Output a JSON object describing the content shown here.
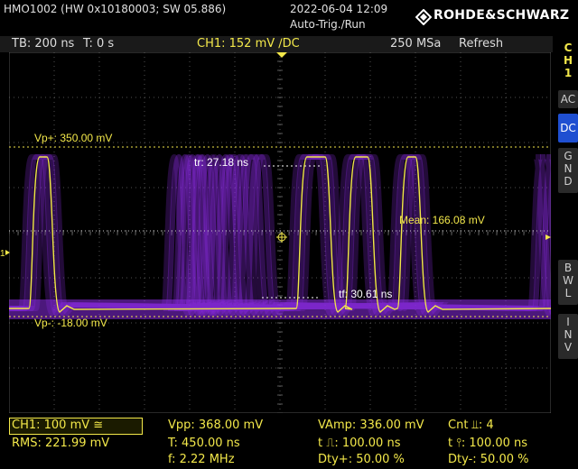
{
  "header": {
    "device": "HMO1002 (HW 0x10180003; SW 05.886)",
    "datetime": "2022-06-04 12:09",
    "trigger_mode": "Auto-Trig./Run",
    "brand": "ROHDE&SCHWARZ"
  },
  "status": {
    "timebase": "TB: 200 ns",
    "trigger_time": "T: 0 s",
    "ch1": "CH1: 152 mV ∕DC",
    "sample_rate": "250 MSa",
    "acq_mode": "Refresh"
  },
  "side": {
    "channel": [
      "C",
      "H",
      "1"
    ],
    "ac": "AC",
    "dc": "DC",
    "gnd": [
      "G",
      "N",
      "D"
    ],
    "bwl": [
      "B",
      "W",
      "L"
    ],
    "inv": [
      "I",
      "N",
      "V"
    ]
  },
  "screen_labels": {
    "vp_plus": "Vp+: 350.00 mV",
    "vp_minus": "Vp-: -18.00 mV",
    "tr": "tr: 27.18 ns",
    "tf": "tf: 30.61 ns",
    "mean": "Mean: 166.08 mV"
  },
  "measurements": {
    "ch1_scale": "CH1: 100 mV ≅",
    "rms": "RMS: 221.99 mV",
    "vpp": "Vpp: 368.00 mV",
    "period": "T: 450.00 ns",
    "freq": "f: 2.22 MHz",
    "vamp": "VAmp: 336.00 mV",
    "pos_width": "t ⎍: 100.00 ns",
    "dty_plus": "Dty+: 50.00 %",
    "count": "Cnt ⫫: 4",
    "neg_width": "t ⫯: 100.00 ns",
    "dty_minus": "Dty-: 50.00 %"
  },
  "colors": {
    "trace": "#f3e84a",
    "persistence": "#8a2be2",
    "grid": "#555555",
    "selected_coupling": "#1f4fd1"
  }
}
